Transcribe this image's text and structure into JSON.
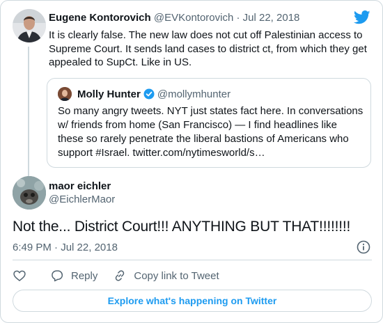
{
  "colors": {
    "accent": "#1d9bf0",
    "muted": "#536471",
    "border": "#cfd9de",
    "text": "#0f1419"
  },
  "parent_tweet": {
    "name": "Eugene Kontorovich",
    "handle": "@EVKontorovich",
    "separator": "·",
    "date": "Jul 22, 2018",
    "text": "It is clearly false. The new law does not cut off Palestinian access to Supreme Court. It sends land cases to district ct, from which they get appealed to SupCt. Like in US.",
    "quoted_tweet": {
      "name": "Molly Hunter",
      "verified": true,
      "handle": "@mollymhunter",
      "text": "So many angry tweets. NYT just states fact here. In conversations w/ friends from home (San Francisco) — I find headlines like these so rarely penetrate the liberal bastions of Americans who support #Israel. twitter.com/nytimesworld/s…"
    }
  },
  "main_tweet": {
    "name": "maor eichler",
    "handle": "@EichlerMaor",
    "text": "Not the... District Court!!! ANYTHING BUT THAT!!!!!!!!",
    "time": "6:49 PM",
    "separator": "·",
    "date": "Jul 22, 2018"
  },
  "actions": {
    "reply_label": "Reply",
    "copy_label": "Copy link to Tweet"
  },
  "explore_label": "Explore what's happening on Twitter",
  "icons": [
    "twitter-bird-icon",
    "verified-badge-icon",
    "info-icon",
    "heart-icon",
    "reply-icon",
    "link-icon"
  ]
}
